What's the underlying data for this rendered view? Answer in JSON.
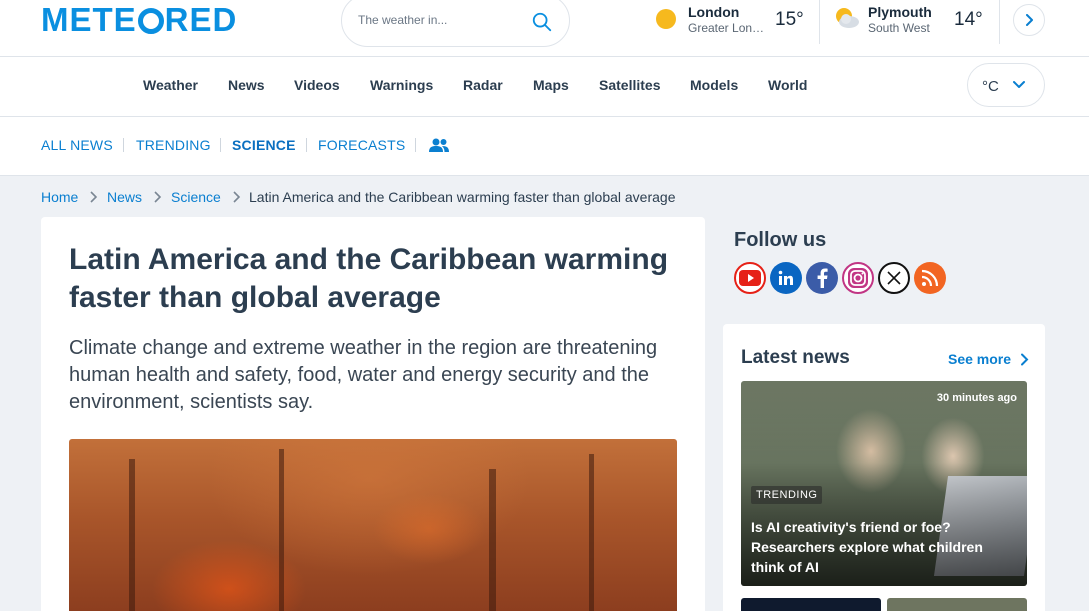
{
  "header": {
    "logo_text_before": "METE",
    "logo_text_after": "RED",
    "search_placeholder": "The weather in...",
    "cities": [
      {
        "name": "London",
        "region": "Greater Lon…",
        "temp": "15°",
        "icon": "sun-icon"
      },
      {
        "name": "Plymouth",
        "region": "South West",
        "temp": "14°",
        "icon": "partly-cloudy-icon"
      }
    ]
  },
  "nav": {
    "items": [
      "Weather",
      "News",
      "Videos",
      "Warnings",
      "Radar",
      "Maps",
      "Satellites",
      "Models",
      "World"
    ],
    "unit": "°C"
  },
  "subnav": {
    "items": [
      "ALL NEWS",
      "TRENDING",
      "SCIENCE",
      "FORECASTS"
    ],
    "active": "SCIENCE"
  },
  "breadcrumb": [
    "Home",
    "News",
    "Science",
    "Latin America and the Caribbean warming faster than global average"
  ],
  "article": {
    "headline": "Latin America and the Caribbean warming faster than global average",
    "lede": "Climate change and extreme weather in the region are threatening human health and safety, food, water and energy security and the environment, scientists say."
  },
  "sidebar": {
    "follow_title": "Follow us",
    "social": [
      {
        "name": "youtube",
        "color": "#e62117"
      },
      {
        "name": "linkedin",
        "color": "#0a66c2"
      },
      {
        "name": "facebook",
        "color": "#1877f2"
      },
      {
        "name": "instagram",
        "color": "#c13584"
      },
      {
        "name": "x",
        "color": "#111111"
      },
      {
        "name": "rss",
        "color": "#f26522"
      }
    ],
    "latest_title": "Latest news",
    "see_more": "See more",
    "card": {
      "time": "30 minutes ago",
      "tag": "TRENDING",
      "title": "Is AI creativity's friend or foe? Researchers explore what children think of AI"
    }
  },
  "colors": {
    "brand": "#0a8fe0",
    "link": "#0a7fd0",
    "text": "#2c3e50",
    "background": "#eef1f5"
  }
}
